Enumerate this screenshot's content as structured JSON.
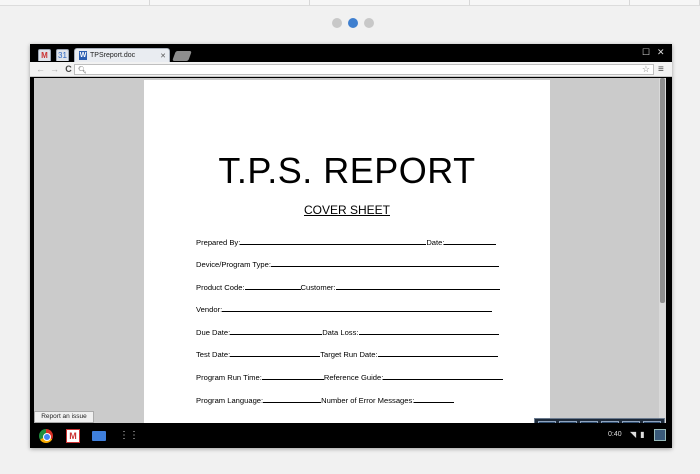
{
  "carousel": {
    "dot_count": 3,
    "active_index": 1
  },
  "tabs": {
    "pinned": [
      {
        "name": "gmail",
        "glyph": "M"
      },
      {
        "name": "calendar",
        "glyph": "31"
      }
    ],
    "active_title": "TPSreport.doc",
    "favicon_glyph": "W"
  },
  "toolbar": {
    "url": "",
    "icons": [
      "back-icon",
      "forward-icon",
      "reload-icon",
      "search-icon",
      "star-icon",
      "menu-icon"
    ]
  },
  "document": {
    "heading": "T.P.S. REPORT",
    "subheading": "COVER SHEET",
    "fields": [
      {
        "row": [
          {
            "label": "Prepared By:",
            "line": 186
          },
          {
            "label": "Date:",
            "line": 52
          }
        ]
      },
      {
        "row": [
          {
            "label": "Device/Program Type:",
            "line": 228
          }
        ]
      },
      {
        "row": [
          {
            "label": "Product Code:",
            "line": 56
          },
          {
            "label": "Customer:",
            "line": 164
          }
        ]
      },
      {
        "row": [
          {
            "label": "Vendor:",
            "line": 270
          }
        ]
      },
      {
        "row": [
          {
            "label": "Due Date:",
            "line": 92
          },
          {
            "label": "Data Loss:",
            "line": 140
          }
        ]
      },
      {
        "row": [
          {
            "label": "Test Date:",
            "line": 90
          },
          {
            "label": "Target Run Date:",
            "line": 120
          }
        ]
      },
      {
        "row": [
          {
            "label": "Program Run Time:",
            "line": 62
          },
          {
            "label": "Reference Guide:",
            "line": 120
          }
        ]
      },
      {
        "row": [
          {
            "label": "Program Language:",
            "line": 58
          },
          {
            "label": "Number of Error Messages:",
            "line": 40
          }
        ]
      }
    ]
  },
  "viewer_controls": [
    "fit-page-icon",
    "fit-width-icon",
    "zoom-out-icon",
    "zoom-in-icon",
    "save-icon",
    "print-icon"
  ],
  "report_button": "Report an issue",
  "shelf": {
    "apps": [
      "chrome-icon",
      "gmail-icon",
      "files-icon",
      "app-launcher-icon"
    ],
    "clock": "0:40"
  },
  "colors": {
    "accent_dot": "#3f7fcf",
    "viewer_bg": "#cbcbcb",
    "frame": "#000000"
  }
}
